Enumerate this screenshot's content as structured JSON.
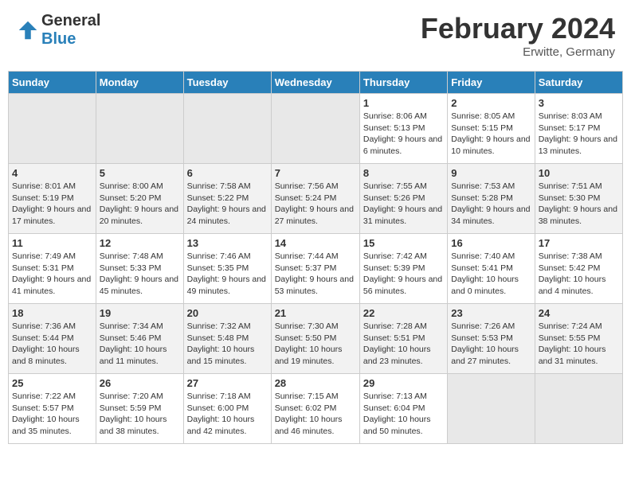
{
  "header": {
    "logo_line1": "General",
    "logo_line2": "Blue",
    "month_year": "February 2024",
    "location": "Erwitte, Germany"
  },
  "weekdays": [
    "Sunday",
    "Monday",
    "Tuesday",
    "Wednesday",
    "Thursday",
    "Friday",
    "Saturday"
  ],
  "weeks": [
    [
      {
        "day": "",
        "info": ""
      },
      {
        "day": "",
        "info": ""
      },
      {
        "day": "",
        "info": ""
      },
      {
        "day": "",
        "info": ""
      },
      {
        "day": "1",
        "info": "Sunrise: 8:06 AM\nSunset: 5:13 PM\nDaylight: 9 hours and 6 minutes."
      },
      {
        "day": "2",
        "info": "Sunrise: 8:05 AM\nSunset: 5:15 PM\nDaylight: 9 hours and 10 minutes."
      },
      {
        "day": "3",
        "info": "Sunrise: 8:03 AM\nSunset: 5:17 PM\nDaylight: 9 hours and 13 minutes."
      }
    ],
    [
      {
        "day": "4",
        "info": "Sunrise: 8:01 AM\nSunset: 5:19 PM\nDaylight: 9 hours and 17 minutes."
      },
      {
        "day": "5",
        "info": "Sunrise: 8:00 AM\nSunset: 5:20 PM\nDaylight: 9 hours and 20 minutes."
      },
      {
        "day": "6",
        "info": "Sunrise: 7:58 AM\nSunset: 5:22 PM\nDaylight: 9 hours and 24 minutes."
      },
      {
        "day": "7",
        "info": "Sunrise: 7:56 AM\nSunset: 5:24 PM\nDaylight: 9 hours and 27 minutes."
      },
      {
        "day": "8",
        "info": "Sunrise: 7:55 AM\nSunset: 5:26 PM\nDaylight: 9 hours and 31 minutes."
      },
      {
        "day": "9",
        "info": "Sunrise: 7:53 AM\nSunset: 5:28 PM\nDaylight: 9 hours and 34 minutes."
      },
      {
        "day": "10",
        "info": "Sunrise: 7:51 AM\nSunset: 5:30 PM\nDaylight: 9 hours and 38 minutes."
      }
    ],
    [
      {
        "day": "11",
        "info": "Sunrise: 7:49 AM\nSunset: 5:31 PM\nDaylight: 9 hours and 41 minutes."
      },
      {
        "day": "12",
        "info": "Sunrise: 7:48 AM\nSunset: 5:33 PM\nDaylight: 9 hours and 45 minutes."
      },
      {
        "day": "13",
        "info": "Sunrise: 7:46 AM\nSunset: 5:35 PM\nDaylight: 9 hours and 49 minutes."
      },
      {
        "day": "14",
        "info": "Sunrise: 7:44 AM\nSunset: 5:37 PM\nDaylight: 9 hours and 53 minutes."
      },
      {
        "day": "15",
        "info": "Sunrise: 7:42 AM\nSunset: 5:39 PM\nDaylight: 9 hours and 56 minutes."
      },
      {
        "day": "16",
        "info": "Sunrise: 7:40 AM\nSunset: 5:41 PM\nDaylight: 10 hours and 0 minutes."
      },
      {
        "day": "17",
        "info": "Sunrise: 7:38 AM\nSunset: 5:42 PM\nDaylight: 10 hours and 4 minutes."
      }
    ],
    [
      {
        "day": "18",
        "info": "Sunrise: 7:36 AM\nSunset: 5:44 PM\nDaylight: 10 hours and 8 minutes."
      },
      {
        "day": "19",
        "info": "Sunrise: 7:34 AM\nSunset: 5:46 PM\nDaylight: 10 hours and 11 minutes."
      },
      {
        "day": "20",
        "info": "Sunrise: 7:32 AM\nSunset: 5:48 PM\nDaylight: 10 hours and 15 minutes."
      },
      {
        "day": "21",
        "info": "Sunrise: 7:30 AM\nSunset: 5:50 PM\nDaylight: 10 hours and 19 minutes."
      },
      {
        "day": "22",
        "info": "Sunrise: 7:28 AM\nSunset: 5:51 PM\nDaylight: 10 hours and 23 minutes."
      },
      {
        "day": "23",
        "info": "Sunrise: 7:26 AM\nSunset: 5:53 PM\nDaylight: 10 hours and 27 minutes."
      },
      {
        "day": "24",
        "info": "Sunrise: 7:24 AM\nSunset: 5:55 PM\nDaylight: 10 hours and 31 minutes."
      }
    ],
    [
      {
        "day": "25",
        "info": "Sunrise: 7:22 AM\nSunset: 5:57 PM\nDaylight: 10 hours and 35 minutes."
      },
      {
        "day": "26",
        "info": "Sunrise: 7:20 AM\nSunset: 5:59 PM\nDaylight: 10 hours and 38 minutes."
      },
      {
        "day": "27",
        "info": "Sunrise: 7:18 AM\nSunset: 6:00 PM\nDaylight: 10 hours and 42 minutes."
      },
      {
        "day": "28",
        "info": "Sunrise: 7:15 AM\nSunset: 6:02 PM\nDaylight: 10 hours and 46 minutes."
      },
      {
        "day": "29",
        "info": "Sunrise: 7:13 AM\nSunset: 6:04 PM\nDaylight: 10 hours and 50 minutes."
      },
      {
        "day": "",
        "info": ""
      },
      {
        "day": "",
        "info": ""
      }
    ]
  ]
}
